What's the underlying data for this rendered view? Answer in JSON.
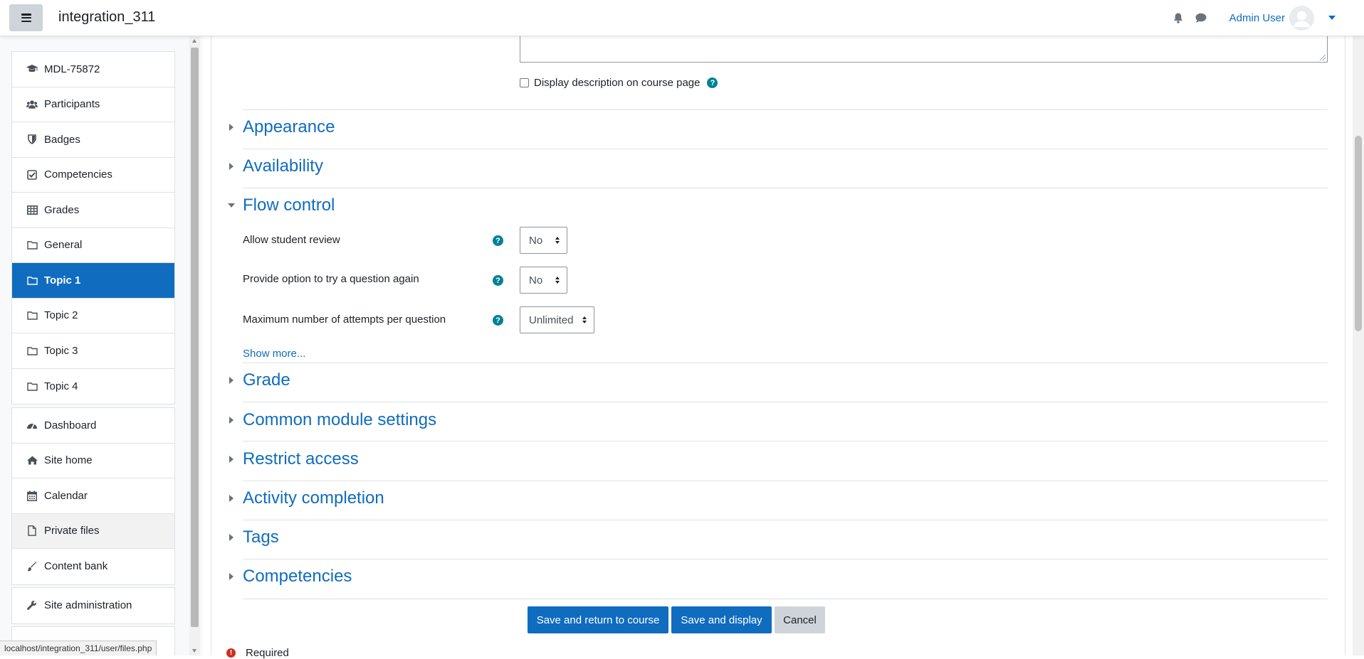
{
  "navbar": {
    "site_name": "integration_311",
    "user_name": "Admin User",
    "icons": [
      "menu-icon",
      "bell-icon",
      "chat-icon",
      "user-avatar-icon",
      "caret-down-icon"
    ]
  },
  "sidebar": {
    "course_items": [
      {
        "label": "MDL-75872",
        "icon": "graduation-cap-icon"
      },
      {
        "label": "Participants",
        "icon": "users-icon"
      },
      {
        "label": "Badges",
        "icon": "shield-icon"
      },
      {
        "label": "Competencies",
        "icon": "check-square-icon"
      },
      {
        "label": "Grades",
        "icon": "table-icon"
      },
      {
        "label": "General",
        "icon": "folder-icon"
      },
      {
        "label": "Topic 1",
        "icon": "folder-icon",
        "active": true
      },
      {
        "label": "Topic 2",
        "icon": "folder-icon"
      },
      {
        "label": "Topic 3",
        "icon": "folder-icon"
      },
      {
        "label": "Topic 4",
        "icon": "folder-icon"
      }
    ],
    "site_items": [
      {
        "label": "Dashboard",
        "icon": "tachometer-icon"
      },
      {
        "label": "Site home",
        "icon": "home-icon"
      },
      {
        "label": "Calendar",
        "icon": "calendar-icon"
      },
      {
        "label": "Private files",
        "icon": "file-icon"
      },
      {
        "label": "Content bank",
        "icon": "paintbrush-icon"
      }
    ],
    "admin_items": [
      {
        "label": "Site administration",
        "icon": "wrench-icon"
      }
    ]
  },
  "status_bar": "localhost/integration_311/user/files.php",
  "form": {
    "display_description_label": "Display description on course page",
    "sections": {
      "appearance": "Appearance",
      "availability": "Availability",
      "flow_control": "Flow control",
      "grade": "Grade",
      "common_module": "Common module settings",
      "restrict_access": "Restrict access",
      "activity_completion": "Activity completion",
      "tags": "Tags",
      "competencies": "Competencies"
    },
    "flow_control_fields": {
      "allow_review_label": "Allow student review",
      "allow_review_value": "No",
      "try_again_label": "Provide option to try a question again",
      "try_again_value": "No",
      "max_attempts_label": "Maximum number of attempts per question",
      "max_attempts_value": "Unlimited"
    },
    "show_more": "Show more...",
    "buttons": {
      "save_return": "Save and return to course",
      "save_display": "Save and display",
      "cancel": "Cancel"
    },
    "required_label": "Required"
  },
  "colors": {
    "primary": "#0f6cbf",
    "help": "#008196",
    "required": "#ca3120"
  }
}
